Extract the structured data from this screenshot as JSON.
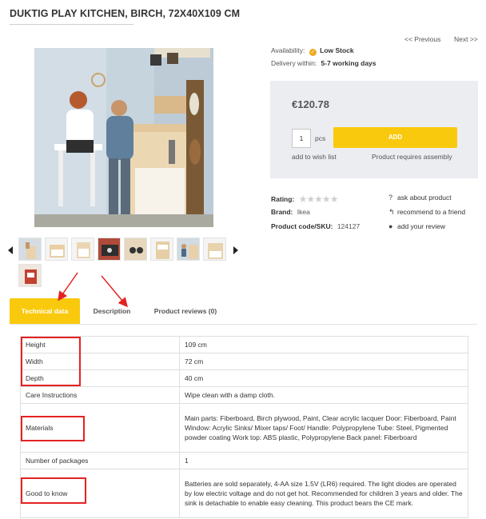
{
  "product": {
    "title": "DUKTIG PLAY KITCHEN, BIRCH, 72X40X109 CM",
    "price": "€120.78",
    "quantity": "1",
    "pcs": "pcs",
    "add": "ADD",
    "wishlist": "add to wish list",
    "assembly": "Product requires assembly"
  },
  "nav": {
    "prev": "<< Previous",
    "next": "Next >>"
  },
  "availability": {
    "label": "Availability:",
    "value": "Low Stock"
  },
  "delivery": {
    "label": "Delivery within:",
    "value": "5-7 working days"
  },
  "rating": {
    "label": "Rating:",
    "stars": "★★★★★",
    "value": 0
  },
  "brand": {
    "label": "Brand:",
    "value": "Ikea"
  },
  "sku": {
    "label": "Product code/SKU:",
    "value": "124127"
  },
  "links": {
    "ask": "ask about product",
    "recommend": "recommend to a friend",
    "review": "add your review"
  },
  "icons": {
    "stock": "check-circle-icon",
    "ask": "question-circle-icon",
    "recommend": "reply-icon",
    "review": "comments-icon",
    "prev_thumb": "caret-left-icon",
    "next_thumb": "caret-right-icon"
  },
  "tabs": [
    {
      "label": "Technical data",
      "active": true
    },
    {
      "label": "Description",
      "active": false
    },
    {
      "label": "Product reviews (0)",
      "active": false
    }
  ],
  "specs": [
    {
      "k": "Height",
      "v": "109 cm"
    },
    {
      "k": "Width",
      "v": "72 cm"
    },
    {
      "k": "Depth",
      "v": "40 cm"
    },
    {
      "k": "Care Instructions",
      "v": "Wipe clean with a damp cloth."
    },
    {
      "k": "Materials",
      "v": "Main parts: Fiberboard, Birch plywood, Paint, Clear acrylic lacquer Door: Fiberboard, Paint Window: Acrylic Sinks/ Mixer taps/ Foot/ Handle: Polypropylene Tube: Steel, Pigmented powder coating Work top: ABS plastic, Polypropylene Back panel: Fiberboard"
    },
    {
      "k": "Number of packages",
      "v": "1"
    },
    {
      "k": "Good to know",
      "v": "Batteries are sold separately, 4-AA size 1.5V (LR6) required. The light diodes are operated by low electric voltage and do not get hot. Recommended for children 3 years and older. The sink is detachable to enable easy cleaning. This product bears the CE mark."
    }
  ],
  "colors": {
    "accent": "#f9c90d",
    "annotation": "#e52222",
    "panel": "#ebedf0"
  }
}
